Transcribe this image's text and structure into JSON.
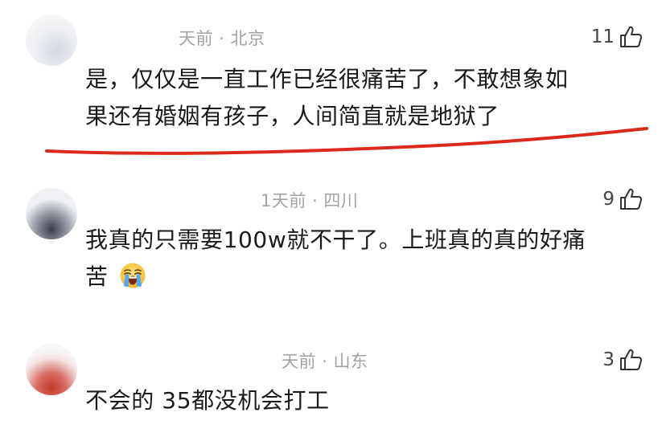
{
  "comments": [
    {
      "meta": "天前 · 北京",
      "likes": "11",
      "text_line1": "是，仅仅是一直工作已经很痛苦了，不敢想象如",
      "text_line2": "果还有婚姻有孩子，人间简直就是地狱了",
      "highlight_color": "#d92a1c"
    },
    {
      "meta": "1天前 · 四川",
      "likes": "9",
      "text_line1": "我真的只需要100w就不干了。上班真的真的好痛",
      "text_line2": "苦",
      "emoji": "loudly-crying-face-emoji"
    },
    {
      "meta": "天前 · 山东",
      "likes": "3",
      "text_line1": "不会的 35都没机会打工"
    }
  ],
  "icons": {
    "like": "thumbs-up-outline-icon"
  }
}
